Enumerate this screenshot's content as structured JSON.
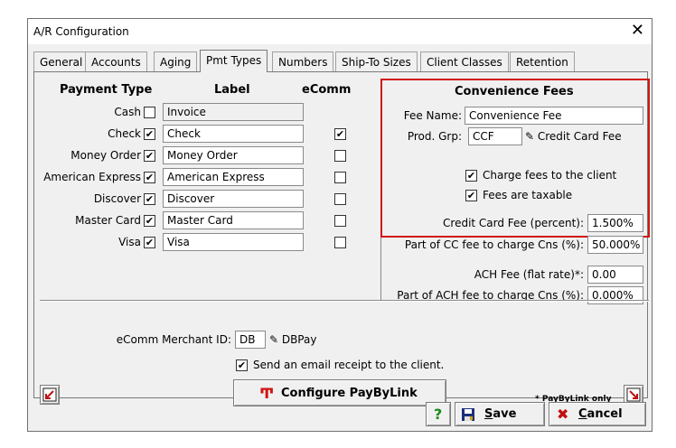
{
  "window": {
    "title": "A/R Configuration"
  },
  "tabs": [
    {
      "label": "General"
    },
    {
      "label": "Accounts"
    },
    {
      "label": "Aging"
    },
    {
      "label": "Pmt Types"
    },
    {
      "label": "Numbers"
    },
    {
      "label": "Ship-To Sizes"
    },
    {
      "label": "Client Classes"
    },
    {
      "label": "Retention"
    }
  ],
  "headers": {
    "payment_type": "Payment Type",
    "label": "Label",
    "ecomm": "eComm"
  },
  "payment_types": [
    {
      "name": "Cash",
      "checked": false,
      "label": "Invoice",
      "ecomm_shown": false,
      "ecomm": false
    },
    {
      "name": "Check",
      "checked": true,
      "label": "Check",
      "ecomm_shown": true,
      "ecomm": true
    },
    {
      "name": "Money Order",
      "checked": true,
      "label": "Money Order",
      "ecomm_shown": true,
      "ecomm": false
    },
    {
      "name": "American Express",
      "checked": true,
      "label": "American Express",
      "ecomm_shown": true,
      "ecomm": false
    },
    {
      "name": "Discover",
      "checked": true,
      "label": "Discover",
      "ecomm_shown": true,
      "ecomm": false
    },
    {
      "name": "Master Card",
      "checked": true,
      "label": "Master Card",
      "ecomm_shown": true,
      "ecomm": false
    },
    {
      "name": "Visa",
      "checked": true,
      "label": "Visa",
      "ecomm_shown": true,
      "ecomm": false
    }
  ],
  "convenience": {
    "title": "Convenience Fees",
    "fee_name_label": "Fee Name:",
    "fee_name": "Convenience Fee",
    "prod_grp_label": "Prod. Grp:",
    "prod_grp": "CCF",
    "prod_grp_desc": "Credit Card Fee",
    "charge_fees_label": "Charge fees to the client",
    "charge_fees": true,
    "taxable_label": "Fees are taxable",
    "taxable": true,
    "cc_fee_label": "Credit Card Fee (percent):",
    "cc_fee": "1.500%",
    "cc_part_label": "Part of CC fee to charge Cns (%):",
    "cc_part": "50.000%",
    "ach_fee_label": "ACH Fee (flat rate)*:",
    "ach_fee": "0.00",
    "ach_part_label": "Part of ACH fee to charge Cns (%):",
    "ach_part": "0.000%"
  },
  "merchant": {
    "label": "eComm Merchant ID:",
    "id": "DB",
    "desc": "DBPay",
    "email_receipt_label": "Send an email receipt to the client.",
    "email_receipt": true
  },
  "buttons": {
    "configure": "Configure PayByLink",
    "paybylink_note": "* PayByLink only",
    "save_accel": "S",
    "save_rest": "ave",
    "cancel_accel": "C",
    "cancel_rest": "ancel"
  },
  "colors": {
    "highlight_border": "#d21414",
    "configure_icon": "#d21414"
  }
}
